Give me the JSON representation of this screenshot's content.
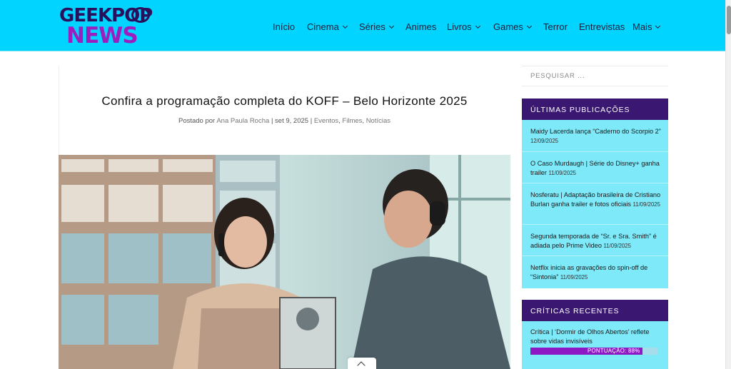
{
  "header": {
    "logo": {
      "line1": "GEEKPOP",
      "line2": "NEWS"
    },
    "nav": [
      {
        "label": "Início",
        "dropdown": false
      },
      {
        "label": "Cinema",
        "dropdown": true
      },
      {
        "label": "Séries",
        "dropdown": true
      },
      {
        "label": "Animes",
        "dropdown": false
      },
      {
        "label": "Livros",
        "dropdown": true
      },
      {
        "label": "Games",
        "dropdown": true
      },
      {
        "label": "Terror",
        "dropdown": false
      },
      {
        "label": "Entrevistas",
        "dropdown": false
      },
      {
        "label": "Mais",
        "dropdown": true
      }
    ]
  },
  "article": {
    "title": "Confira a programação completa do KOFF – Belo Horizonte 2025",
    "meta": {
      "posted_by_prefix": "Postado por",
      "author": "Ana Paula Rocha",
      "date": "set 9, 2025",
      "categories": [
        "Eventos",
        "Filmes",
        "Notícias"
      ]
    }
  },
  "sidebar": {
    "search_placeholder": "PESQUISAR ...",
    "latest": {
      "heading": "ÚLTIMAS PUBLICAÇÕES",
      "posts": [
        {
          "title": "Maidy Lacerda lança “Caderno do Scorpio 2”",
          "date": "12/09/2025"
        },
        {
          "title": "O Caso Murdaugh | Série do Disney+ ganha trailer",
          "date": "11/09/2025"
        },
        {
          "title": "Nosferatu | Adaptação brasileira de Cristiano Burlan ganha trailer e fotos oficiais",
          "date": "11/09/2025"
        },
        {
          "title": "Segunda temporada de “Sr. e Sra. Smith” é adiada pelo Prime Video",
          "date": "11/09/2025"
        },
        {
          "title": "Netflix inicia as gravações do spin-off de “Sintonia”",
          "date": "11/09/2025"
        }
      ]
    },
    "reviews": {
      "heading": "CRÍTICAS RECENTES",
      "items": [
        {
          "title": "Crítica | ‘Dormir de Olhos Abertos’ reflete sobre vidas invisíveis",
          "score_label": "PONTUAÇÃO: 88%",
          "score": 0.88
        }
      ]
    }
  },
  "colors": {
    "header_bg": "#00d4ff",
    "widget_head": "#3a1770",
    "widget_body": "#7de9f9",
    "score_fill": "#8e19c4"
  }
}
